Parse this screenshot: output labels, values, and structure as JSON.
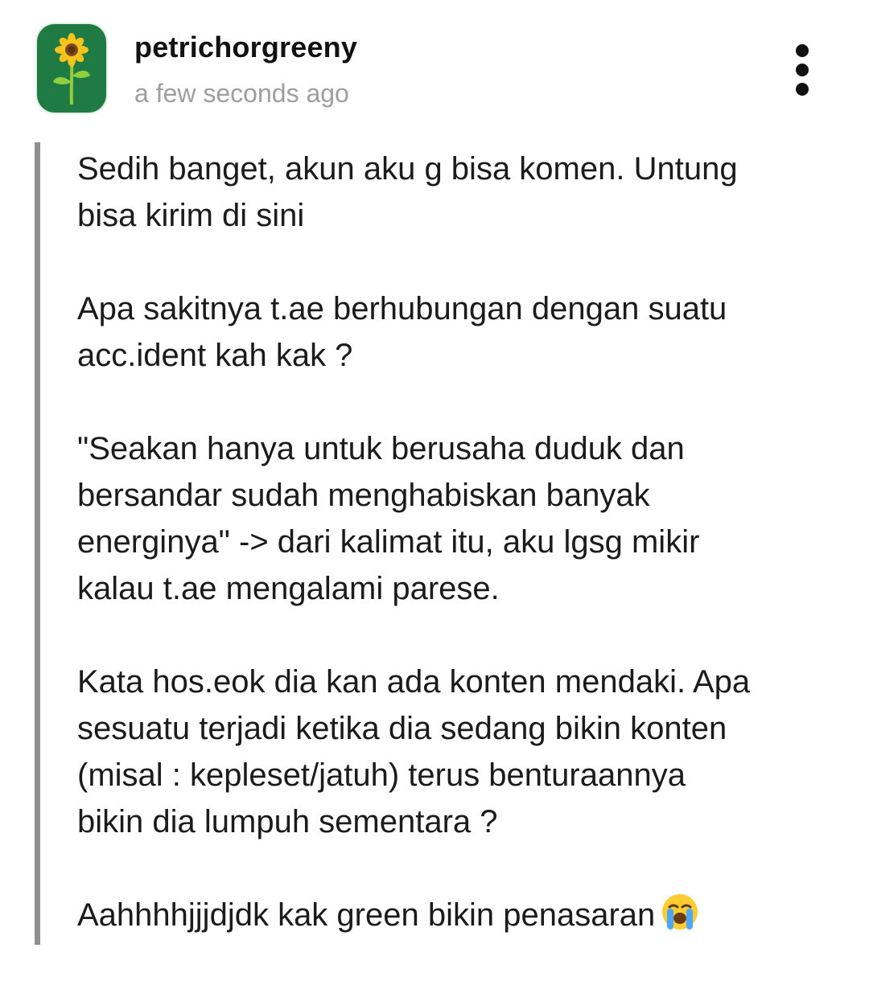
{
  "post": {
    "username": "petrichorgreeny",
    "timestamp": "a few seconds ago",
    "avatar_icon": "sunflower-icon",
    "avatar_color": "#1f7a44",
    "menu_icon": "more-vertical-icon"
  },
  "comment": {
    "paragraphs": [
      {
        "lines": [
          "Sedih banget, akun aku g bisa komen. Untung",
          "bisa kirim di sini"
        ]
      },
      {
        "lines": [
          "Apa sakitnya t.ae berhubungan dengan suatu",
          "acc.ident kah kak ?"
        ]
      },
      {
        "lines": [
          "\"Seakan hanya untuk berusaha duduk dan",
          "bersandar sudah menghabiskan banyak",
          "energinya\" -> dari kalimat itu, aku lgsg mikir",
          "kalau t.ae mengalami parese."
        ]
      },
      {
        "lines": [
          "Kata hos.eok dia kan ada konten mendaki. Apa",
          "sesuatu terjadi ketika dia sedang bikin konten",
          "(misal : kepleset/jatuh) terus benturaannya",
          "bikin dia lumpuh sementara ?"
        ]
      },
      {
        "lines": [
          "Aahhhhjjjdjdk kak green bikin penasaran"
        ],
        "emoji": "loudly-crying-face-icon"
      }
    ]
  }
}
